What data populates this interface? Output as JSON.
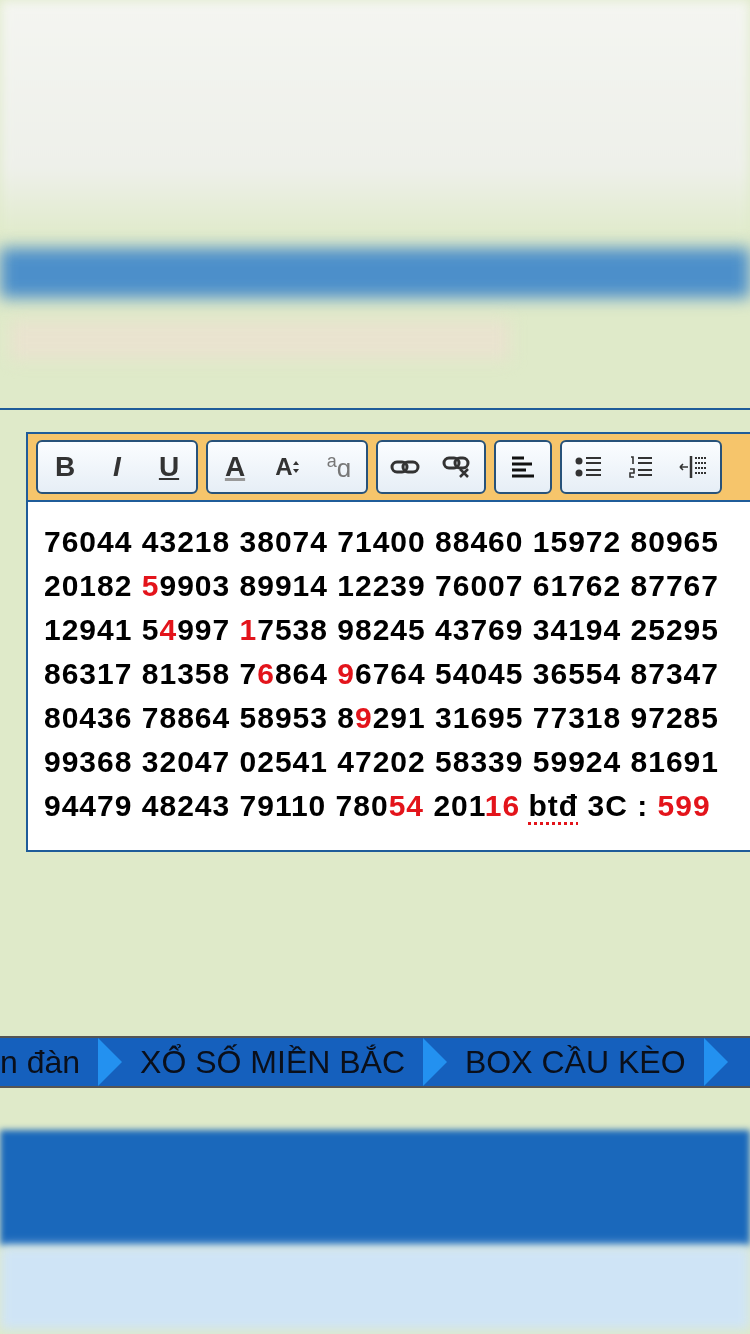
{
  "editor": {
    "toolbar": [
      {
        "buttons": [
          {
            "kind": "bold",
            "label": "B"
          },
          {
            "kind": "italic",
            "label": "I"
          },
          {
            "kind": "underline",
            "label": "U"
          }
        ]
      },
      {
        "buttons": [
          {
            "kind": "font-color",
            "label": "A"
          },
          {
            "kind": "font-size",
            "label": "A"
          },
          {
            "kind": "format",
            "label": "$^{a}$ɑ"
          }
        ]
      },
      {
        "buttons": [
          {
            "kind": "link"
          },
          {
            "kind": "unlink"
          }
        ]
      },
      {
        "buttons": [
          {
            "kind": "align-left"
          }
        ]
      },
      {
        "buttons": [
          {
            "kind": "bullet-list"
          },
          {
            "kind": "numbered-list"
          },
          {
            "kind": "outdent"
          }
        ]
      }
    ],
    "lines": [
      [
        {
          "kind": "plain",
          "text": "76044 43218 38074 71400 88460 15972 80965"
        }
      ],
      [
        {
          "kind": "plain",
          "text": "20182 "
        },
        {
          "kind": "highlight",
          "text": "5"
        },
        {
          "kind": "plain",
          "text": "9903 89914 12239 76007 61762 87767"
        }
      ],
      [
        {
          "kind": "plain",
          "text": "12941 5"
        },
        {
          "kind": "highlight",
          "text": "4"
        },
        {
          "kind": "plain",
          "text": "997 "
        },
        {
          "kind": "highlight",
          "text": "1"
        },
        {
          "kind": "plain",
          "text": "7538 98245 43769 34194 25295"
        }
      ],
      [
        {
          "kind": "plain",
          "text": "86317 81358 7"
        },
        {
          "kind": "highlight",
          "text": "6"
        },
        {
          "kind": "plain",
          "text": "864 "
        },
        {
          "kind": "highlight",
          "text": "9"
        },
        {
          "kind": "plain",
          "text": "6764 54045 36554 87347"
        }
      ],
      [
        {
          "kind": "plain",
          "text": "80436 78864 58953 8"
        },
        {
          "kind": "highlight",
          "text": "9"
        },
        {
          "kind": "plain",
          "text": "291 31695 77318 97285"
        }
      ],
      [
        {
          "kind": "plain",
          "text": "99368 32047 02541 47202 58339 59924 81691"
        }
      ],
      [
        {
          "kind": "plain",
          "text": "94479 48243 79110 780"
        },
        {
          "kind": "highlight",
          "text": "54"
        },
        {
          "kind": "plain",
          "text": " 201"
        },
        {
          "kind": "highlight",
          "text": "16"
        },
        {
          "kind": "misspelled",
          "text": "btđ",
          "gap_before": true
        },
        {
          "kind": "plain",
          "text": " 3C : "
        },
        {
          "kind": "highlight",
          "text": "599"
        }
      ]
    ]
  },
  "breadcrumb": [
    "n đàn",
    "XỔ SỐ MIỀN BẮC",
    "BOX CẦU KÈO"
  ]
}
